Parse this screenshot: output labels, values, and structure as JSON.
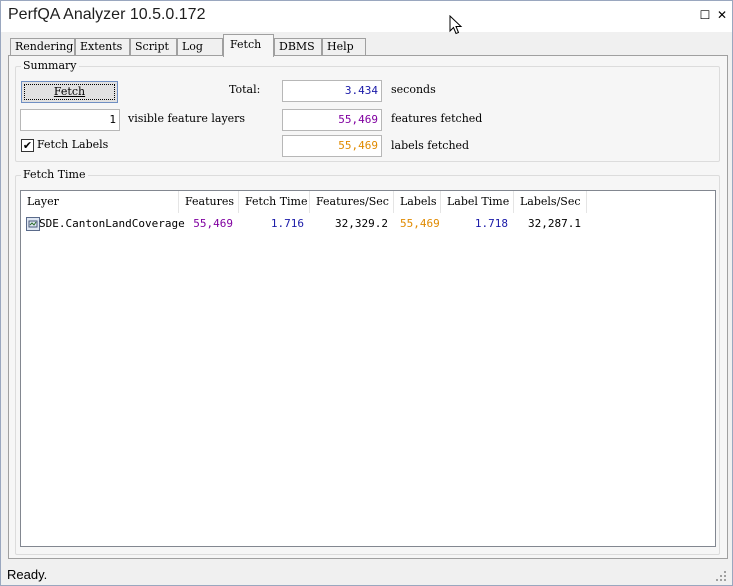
{
  "window": {
    "title": "PerfQA Analyzer 10.5.0.172",
    "maximize_glyph": "☐",
    "close_glyph": "✕"
  },
  "tabs": [
    {
      "label": "Rendering",
      "active": false
    },
    {
      "label": "Extents",
      "active": false
    },
    {
      "label": "Script",
      "active": false
    },
    {
      "label": "Log",
      "active": false
    },
    {
      "label": "Fetch",
      "active": true
    },
    {
      "label": "DBMS",
      "active": false
    },
    {
      "label": "Help",
      "active": false
    }
  ],
  "summary": {
    "group_label": "Summary",
    "fetch_button": "Fetch",
    "total_label": "Total:",
    "total_value": "3.434",
    "total_unit": "seconds",
    "layers_value": "1",
    "layers_label": "visible feature layers",
    "features_value": "55,469",
    "features_label": "features fetched",
    "fetch_labels_checkbox": "Fetch Labels",
    "fetch_labels_checked": true,
    "labels_value": "55,469",
    "labels_label": "labels fetched"
  },
  "fetch_time": {
    "group_label": "Fetch Time",
    "columns": [
      "Layer",
      "Features",
      "Fetch Time",
      "Features/Sec",
      "Labels",
      "Label Time",
      "Labels/Sec"
    ],
    "rows": [
      {
        "layer": "SDE.CantonLandCoverage",
        "features": "55,469",
        "fetch_time": "1.716",
        "features_per_sec": "32,329.2",
        "labels": "55,469",
        "label_time": "1.718",
        "labels_per_sec": "32,287.1"
      }
    ]
  },
  "status": {
    "text": "Ready."
  },
  "colors": {
    "features": "#8000a0",
    "time": "#1a1aa8",
    "labels": "#e08a00"
  }
}
